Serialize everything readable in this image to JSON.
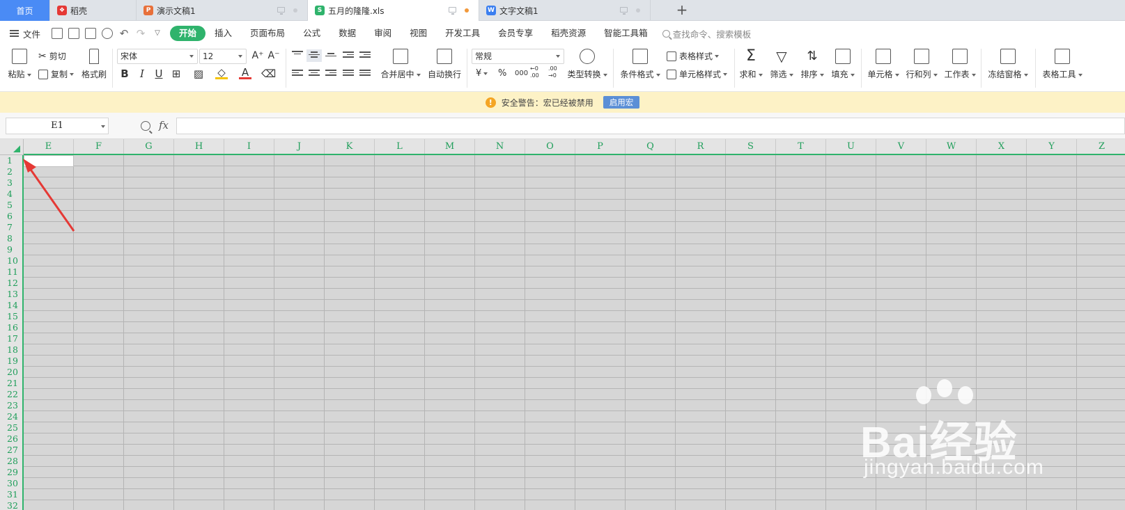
{
  "tabs": {
    "home": "首页",
    "items": [
      {
        "label": "稻壳",
        "icon": "docer-icon",
        "color": "#e53935"
      },
      {
        "label": "演示文稿1",
        "icon": "presentation-icon",
        "color": "#e8703a"
      },
      {
        "label": "五月的隆隆.xls",
        "icon": "spreadsheet-icon",
        "color": "#2fb36c"
      },
      {
        "label": "文字文稿1",
        "icon": "writer-icon",
        "color": "#3b7ff0"
      }
    ]
  },
  "menu": {
    "file": "文件",
    "tabs": [
      "开始",
      "插入",
      "页面布局",
      "公式",
      "数据",
      "审阅",
      "视图",
      "开发工具",
      "会员专享",
      "稻壳资源",
      "智能工具箱"
    ],
    "active_tab": "开始",
    "search_placeholder": "查找命令、搜索模板"
  },
  "ribbon": {
    "paste": "粘贴",
    "cut": "剪切",
    "copy": "复制",
    "format_painter": "格式刷",
    "font_name": "宋体",
    "font_size": "12",
    "merge_center": "合并居中",
    "wrap_text": "自动换行",
    "number_format": "常规",
    "type_convert": "类型转换",
    "conditional_format": "条件格式",
    "table_style": "表格样式",
    "cell_style": "单元格样式",
    "sum": "求和",
    "filter": "筛选",
    "sort": "排序",
    "fill": "填充",
    "cell": "单元格",
    "row_col": "行和列",
    "worksheet": "工作表",
    "freeze": "冻结窗格",
    "table_tools": "表格工具",
    "currency_symbol": "¥",
    "percent_symbol": "%",
    "thousands_symbol": "000",
    "inc_decimal": "←0 .00",
    "dec_decimal": ".00 →0"
  },
  "warning": {
    "text": "安全警告：宏已经被禁用",
    "button": "启用宏"
  },
  "formula_bar": {
    "name_box": "E1",
    "fx": "fx",
    "value": ""
  },
  "grid": {
    "columns": [
      "E",
      "F",
      "G",
      "H",
      "I",
      "J",
      "K",
      "L",
      "M",
      "N",
      "O",
      "P",
      "Q",
      "R",
      "S",
      "T",
      "U",
      "V",
      "W",
      "X",
      "Y",
      "Z"
    ],
    "rows": [
      "1",
      "2",
      "3",
      "4",
      "5",
      "6",
      "7",
      "8",
      "9",
      "10",
      "11",
      "12",
      "13",
      "14",
      "15",
      "16",
      "17",
      "18",
      "19",
      "20",
      "21",
      "22",
      "23",
      "24",
      "25",
      "26",
      "27",
      "28",
      "29",
      "30",
      "31",
      "32"
    ],
    "selected_cell": "E1"
  },
  "watermark": {
    "brand": "Bai经验",
    "url": "jingyan.baidu.com"
  },
  "colors": {
    "accent": "#2fb36c",
    "home_tab": "#4a8bf5",
    "warning_bg": "#fdf2c6",
    "annotation_arrow": "#e53935"
  }
}
